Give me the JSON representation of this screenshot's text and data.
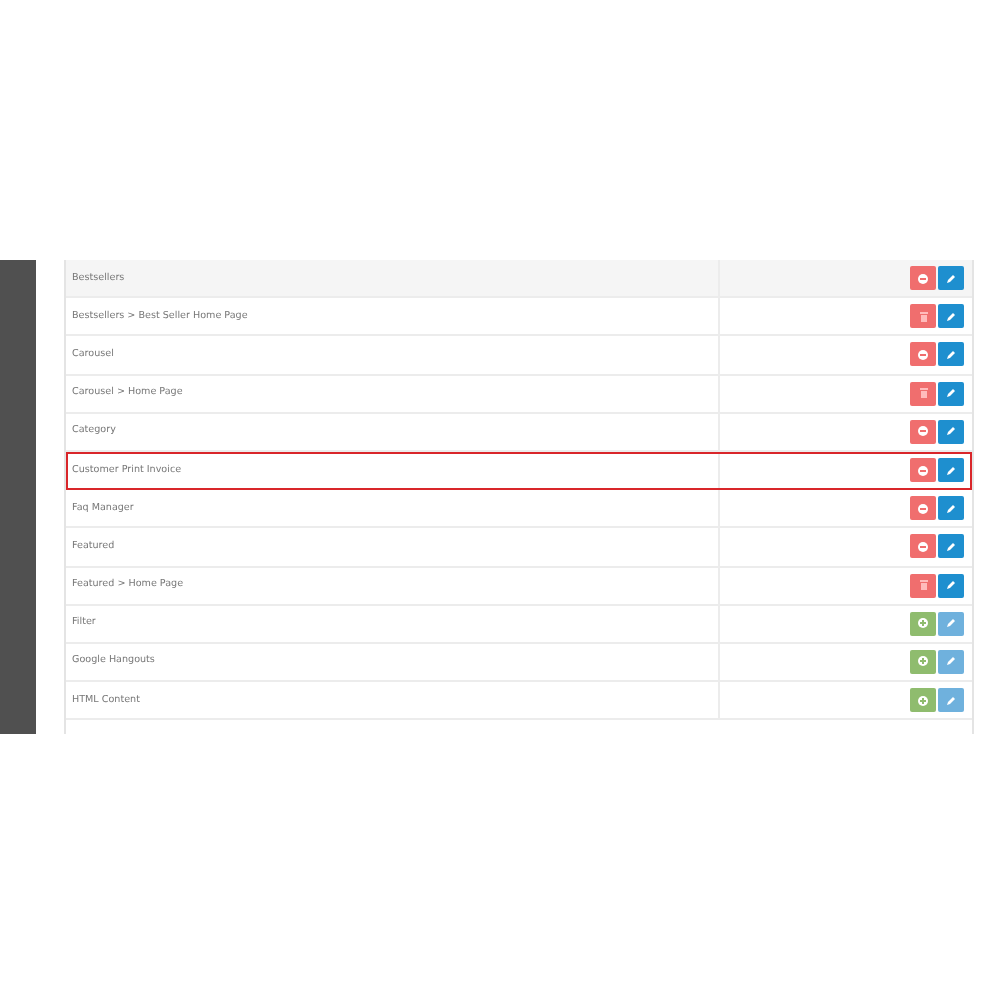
{
  "modules": [
    {
      "name": "Bestsellers",
      "kind": "installed",
      "remove": {
        "kind": "circle"
      },
      "selected": false
    },
    {
      "name": "Bestsellers > Best Seller Home Page",
      "kind": "installed",
      "remove": {
        "kind": "trash"
      },
      "selected": false
    },
    {
      "name": "Carousel",
      "kind": "installed",
      "remove": {
        "kind": "circle"
      },
      "selected": false
    },
    {
      "name": "Carousel > Home Page",
      "kind": "installed",
      "remove": {
        "kind": "trash"
      },
      "selected": false
    },
    {
      "name": "Category",
      "kind": "installed",
      "remove": {
        "kind": "circle"
      },
      "selected": false
    },
    {
      "name": "Customer Print Invoice",
      "kind": "installed",
      "remove": {
        "kind": "circle"
      },
      "selected": true
    },
    {
      "name": "Faq Manager",
      "kind": "installed",
      "remove": {
        "kind": "circle"
      },
      "selected": false
    },
    {
      "name": "Featured",
      "kind": "installed",
      "remove": {
        "kind": "circle"
      },
      "selected": false
    },
    {
      "name": "Featured > Home Page",
      "kind": "installed",
      "remove": {
        "kind": "trash"
      },
      "selected": false
    },
    {
      "name": "Filter",
      "kind": "uninstalled",
      "selected": false
    },
    {
      "name": "Google Hangouts",
      "kind": "uninstalled",
      "selected": false
    },
    {
      "name": "HTML Content",
      "kind": "uninstalled",
      "selected": false
    }
  ]
}
